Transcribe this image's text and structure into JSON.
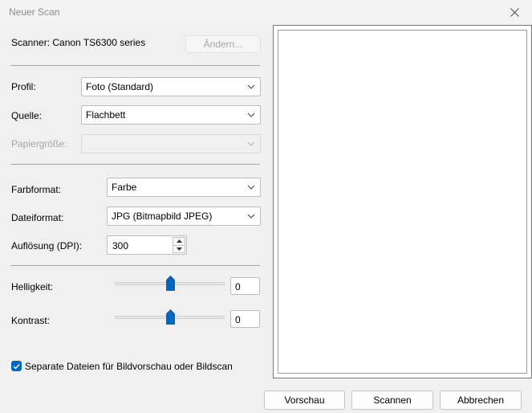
{
  "window": {
    "title": "Neuer Scan"
  },
  "scanner": {
    "label": "Scanner: Canon TS6300 series",
    "change_button": "Ändern..."
  },
  "profile": {
    "label": "Profil:",
    "value": "Foto (Standard)"
  },
  "source": {
    "label": "Quelle:",
    "value": "Flachbett"
  },
  "paper_size": {
    "label": "Papiergröße:",
    "value": ""
  },
  "color_format": {
    "label": "Farbformat:",
    "value": "Farbe"
  },
  "file_format": {
    "label": "Dateiformat:",
    "value": "JPG (Bitmapbild JPEG)"
  },
  "resolution": {
    "label": "Auflösung (DPI):",
    "value": "300"
  },
  "brightness": {
    "label": "Helligkeit:",
    "value": "0",
    "slider_fraction": 0.5
  },
  "contrast": {
    "label": "Kontrast:",
    "value": "0",
    "slider_fraction": 0.5
  },
  "separate_files": {
    "label": "Separate Dateien für Bildvorschau oder Bildscan",
    "checked": true
  },
  "buttons": {
    "preview": "Vorschau",
    "scan": "Scannen",
    "cancel": "Abbrechen"
  },
  "colors": {
    "accent": "#0067c0"
  },
  "icons": {
    "close": "close-icon",
    "chevron": "chevron-down-icon",
    "check": "checkmark-icon"
  }
}
